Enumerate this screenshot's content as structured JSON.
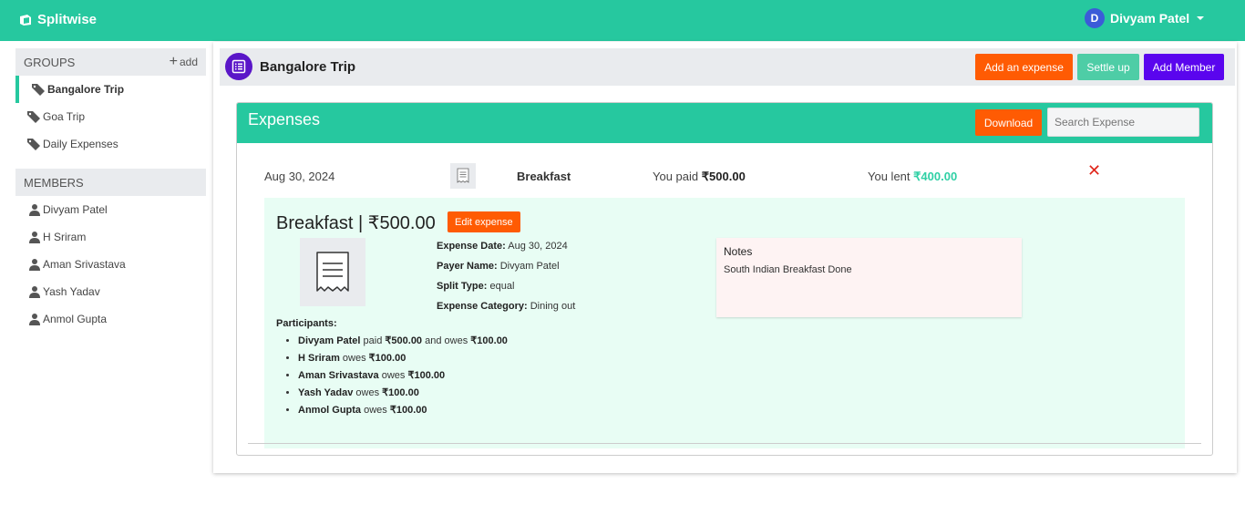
{
  "app": {
    "brand": "Splitwise"
  },
  "user": {
    "initial": "D",
    "name": "Divyam Patel"
  },
  "sidebar": {
    "groups_heading": "GROUPS",
    "add_label": "add",
    "groups": [
      {
        "label": "Bangalore Trip",
        "active": true
      },
      {
        "label": "Goa Trip"
      },
      {
        "label": "Daily Expenses"
      }
    ],
    "members_heading": "MEMBERS",
    "members": [
      "Divyam Patel",
      "H Sriram",
      "Aman Srivastava",
      "Yash Yadav",
      "Anmol Gupta"
    ]
  },
  "group": {
    "title": "Bangalore Trip",
    "add_expense_label": "Add an expense",
    "settle_up_label": "Settle up",
    "add_member_label": "Add Member"
  },
  "expenses": {
    "title": "Expenses",
    "download_label": "Download",
    "search_placeholder": "Search Expense",
    "row": {
      "date": "Aug 30, 2024",
      "name": "Breakfast",
      "paid_prefix": "You paid",
      "paid_amount": "₹500.00",
      "lent_prefix": "You lent",
      "lent_amount": "₹400.00",
      "delete_glyph": "✕"
    },
    "detail": {
      "title": "Breakfast | ₹500.00",
      "edit_label": "Edit expense",
      "fields": [
        {
          "label": "Expense Date:",
          "value": "Aug 30, 2024"
        },
        {
          "label": "Payer Name:",
          "value": "Divyam Patel"
        },
        {
          "label": "Split Type:",
          "value": "equal"
        },
        {
          "label": "Expense Category:",
          "value": "Dining out"
        }
      ],
      "notes_heading": "Notes",
      "notes_text": "South Indian Breakfast Done",
      "participants_heading": "Participants:",
      "participants": [
        {
          "name": "Divyam Patel",
          "pre": "paid",
          "paid": "₹500.00",
          "mid": "and owes",
          "owes": "₹100.00"
        },
        {
          "name": "H Sriram",
          "mid": "owes",
          "owes": "₹100.00"
        },
        {
          "name": "Aman Srivastava",
          "mid": "owes",
          "owes": "₹100.00"
        },
        {
          "name": "Yash Yadav",
          "mid": "owes",
          "owes": "₹100.00"
        },
        {
          "name": "Anmol Gupta",
          "mid": "owes",
          "owes": "₹100.00"
        }
      ]
    }
  },
  "colors": {
    "primary": "#26c89f",
    "orange": "#ff5b03",
    "purple": "#5a16c8",
    "settle": "#4ecda6",
    "danger": "#e0261b"
  }
}
